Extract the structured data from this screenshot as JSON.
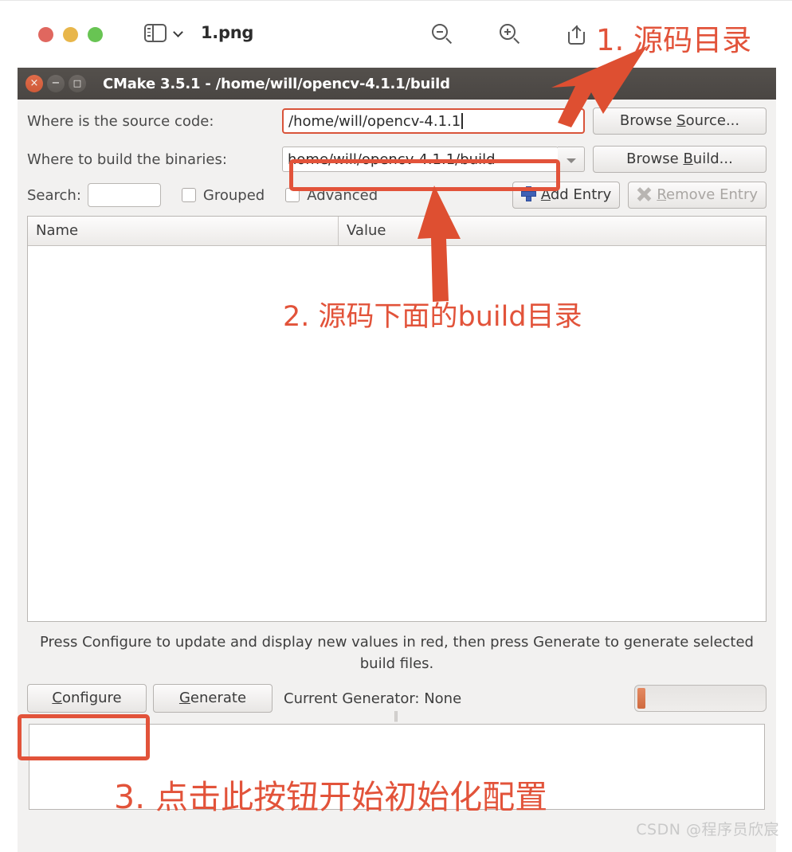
{
  "viewer": {
    "filename": "1.png",
    "icons": {
      "traffic_close": "close-dot-icon",
      "traffic_minimize": "minimize-dot-icon",
      "traffic_zoom": "zoom-dot-icon",
      "sidebar": "sidebar-toggle-icon",
      "chevron": "chevron-down-icon",
      "zoom_out": "zoom-out-icon",
      "zoom_in": "zoom-in-icon",
      "share": "share-icon"
    }
  },
  "cmake": {
    "title": "CMake 3.5.1 - /home/will/opencv-4.1.1/build",
    "titlebar_buttons": {
      "close": "×",
      "minimize": "−",
      "maximize": "□"
    },
    "source": {
      "label": "Where is the source code:",
      "value": "/home/will/opencv-4.1.1",
      "browse_label_pre": "Browse ",
      "browse_label_key": "S",
      "browse_label_post": "ource..."
    },
    "build": {
      "label": "Where to build the binaries:",
      "value": "home/will/opencv-4.1.1/build",
      "browse_label_pre": "Browse ",
      "browse_label_key": "B",
      "browse_label_post": "uild..."
    },
    "toolbar": {
      "search_label": "Search:",
      "search_value": "",
      "grouped_label": "Grouped",
      "grouped_checked": false,
      "advanced_label": "Advanced",
      "advanced_checked": false,
      "add_entry_pre": "",
      "add_entry_key": "A",
      "add_entry_post": "dd Entry",
      "remove_entry_pre": "",
      "remove_entry_key": "R",
      "remove_entry_post": "emove Entry",
      "remove_entry_disabled": true
    },
    "table": {
      "columns": [
        "Name",
        "Value"
      ],
      "rows": []
    },
    "hint": "Press Configure to update and display new values in red, then press Generate to generate selected build files.",
    "actions": {
      "configure_key": "C",
      "configure_post": "onfigure",
      "generate_key": "G",
      "generate_post": "enerate",
      "current_generator": "Current Generator: None",
      "progress_percent": 0
    },
    "grip": "‖"
  },
  "annotations": {
    "accent_color": "#e2533a",
    "items": [
      {
        "text": "1. 源码目录"
      },
      {
        "text": "2. 源码下面的build目录"
      },
      {
        "text": "3. 点击此按钮开始初始化配置"
      }
    ]
  },
  "watermark": "CSDN @程序员欣宸"
}
